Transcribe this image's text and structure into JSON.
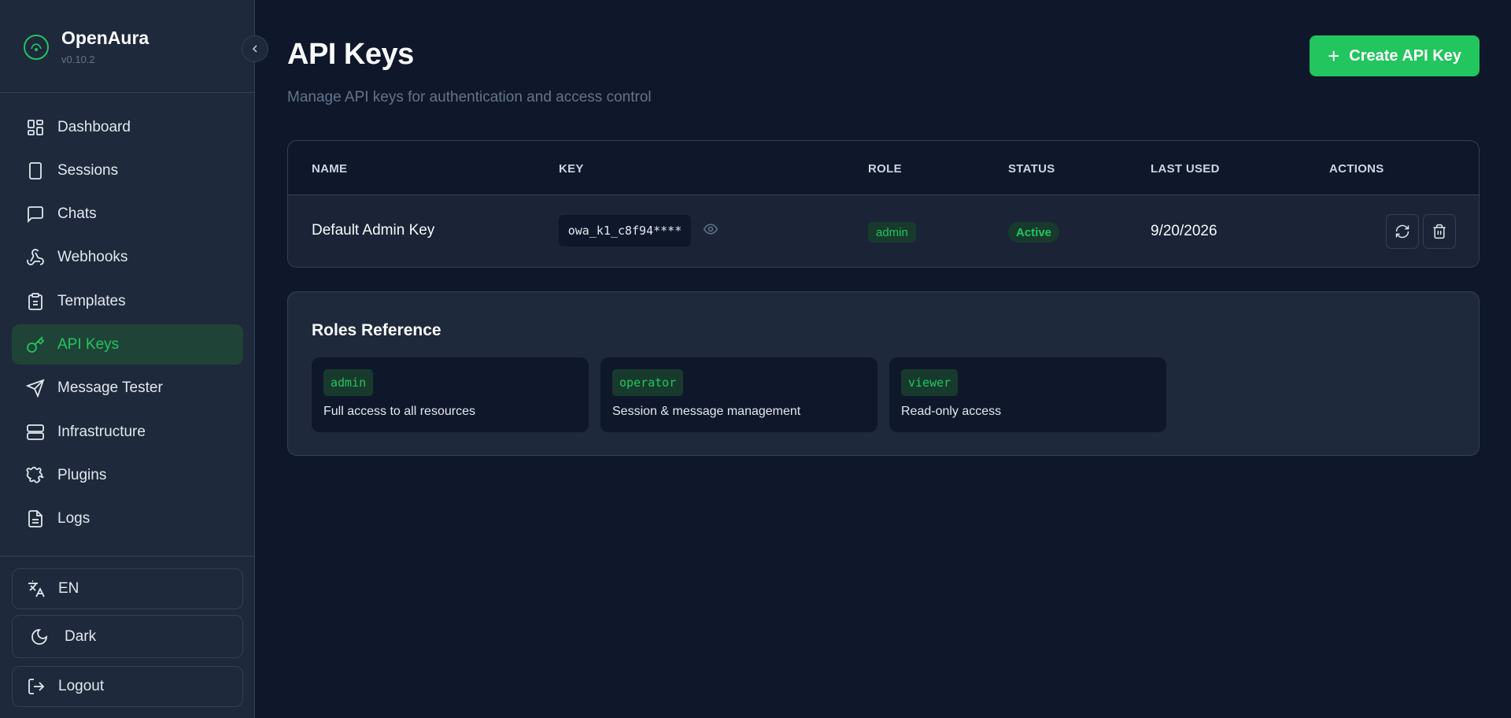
{
  "app": {
    "name": "OpenAura",
    "version": "v0.10.2"
  },
  "sidebar": {
    "items": [
      {
        "label": "Dashboard",
        "icon": "dashboard-icon",
        "active": false
      },
      {
        "label": "Sessions",
        "icon": "phone-icon",
        "active": false
      },
      {
        "label": "Chats",
        "icon": "chat-icon",
        "active": false
      },
      {
        "label": "Webhooks",
        "icon": "webhook-icon",
        "active": false
      },
      {
        "label": "Templates",
        "icon": "clipboard-icon",
        "active": false
      },
      {
        "label": "API Keys",
        "icon": "key-icon",
        "active": true
      },
      {
        "label": "Message Tester",
        "icon": "send-icon",
        "active": false
      },
      {
        "label": "Infrastructure",
        "icon": "server-icon",
        "active": false
      },
      {
        "label": "Plugins",
        "icon": "puzzle-icon",
        "active": false
      },
      {
        "label": "Logs",
        "icon": "file-text-icon",
        "active": false
      }
    ],
    "language": "EN",
    "theme": "Dark",
    "logout": "Logout"
  },
  "header": {
    "title": "API Keys",
    "subtitle": "Manage API keys for authentication and access control",
    "create_label": "Create API Key"
  },
  "table": {
    "columns": [
      "NAME",
      "KEY",
      "ROLE",
      "STATUS",
      "LAST USED",
      "ACTIONS"
    ],
    "rows": [
      {
        "name": "Default Admin Key",
        "key": "owa_k1_c8f94****",
        "role": "admin",
        "status": "Active",
        "last_used": "9/20/2026"
      }
    ]
  },
  "roles": {
    "title": "Roles Reference",
    "items": [
      {
        "code": "admin",
        "description": "Full access to all resources"
      },
      {
        "code": "operator",
        "description": "Session & message management"
      },
      {
        "code": "viewer",
        "description": "Read-only access"
      }
    ]
  },
  "colors": {
    "accent": "#22c55e",
    "background": "#0f172a",
    "sidebar": "#1e293b",
    "border": "#334155"
  }
}
